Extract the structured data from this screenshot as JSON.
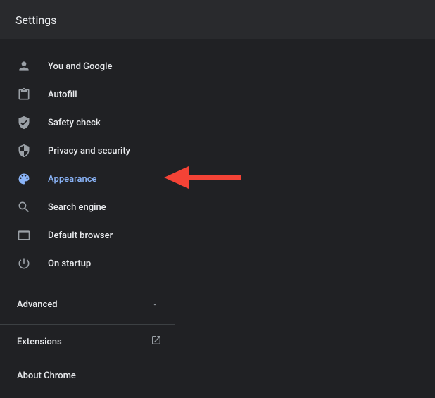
{
  "header": {
    "title": "Settings"
  },
  "sidebar": {
    "items": [
      {
        "label": "You and Google"
      },
      {
        "label": "Autofill"
      },
      {
        "label": "Safety check"
      },
      {
        "label": "Privacy and security"
      },
      {
        "label": "Appearance"
      },
      {
        "label": "Search engine"
      },
      {
        "label": "Default browser"
      },
      {
        "label": "On startup"
      }
    ],
    "advanced_label": "Advanced",
    "extensions_label": "Extensions",
    "about_label": "About Chrome"
  },
  "colors": {
    "accent": "#8ab4f8",
    "annotation": "#f44336"
  }
}
